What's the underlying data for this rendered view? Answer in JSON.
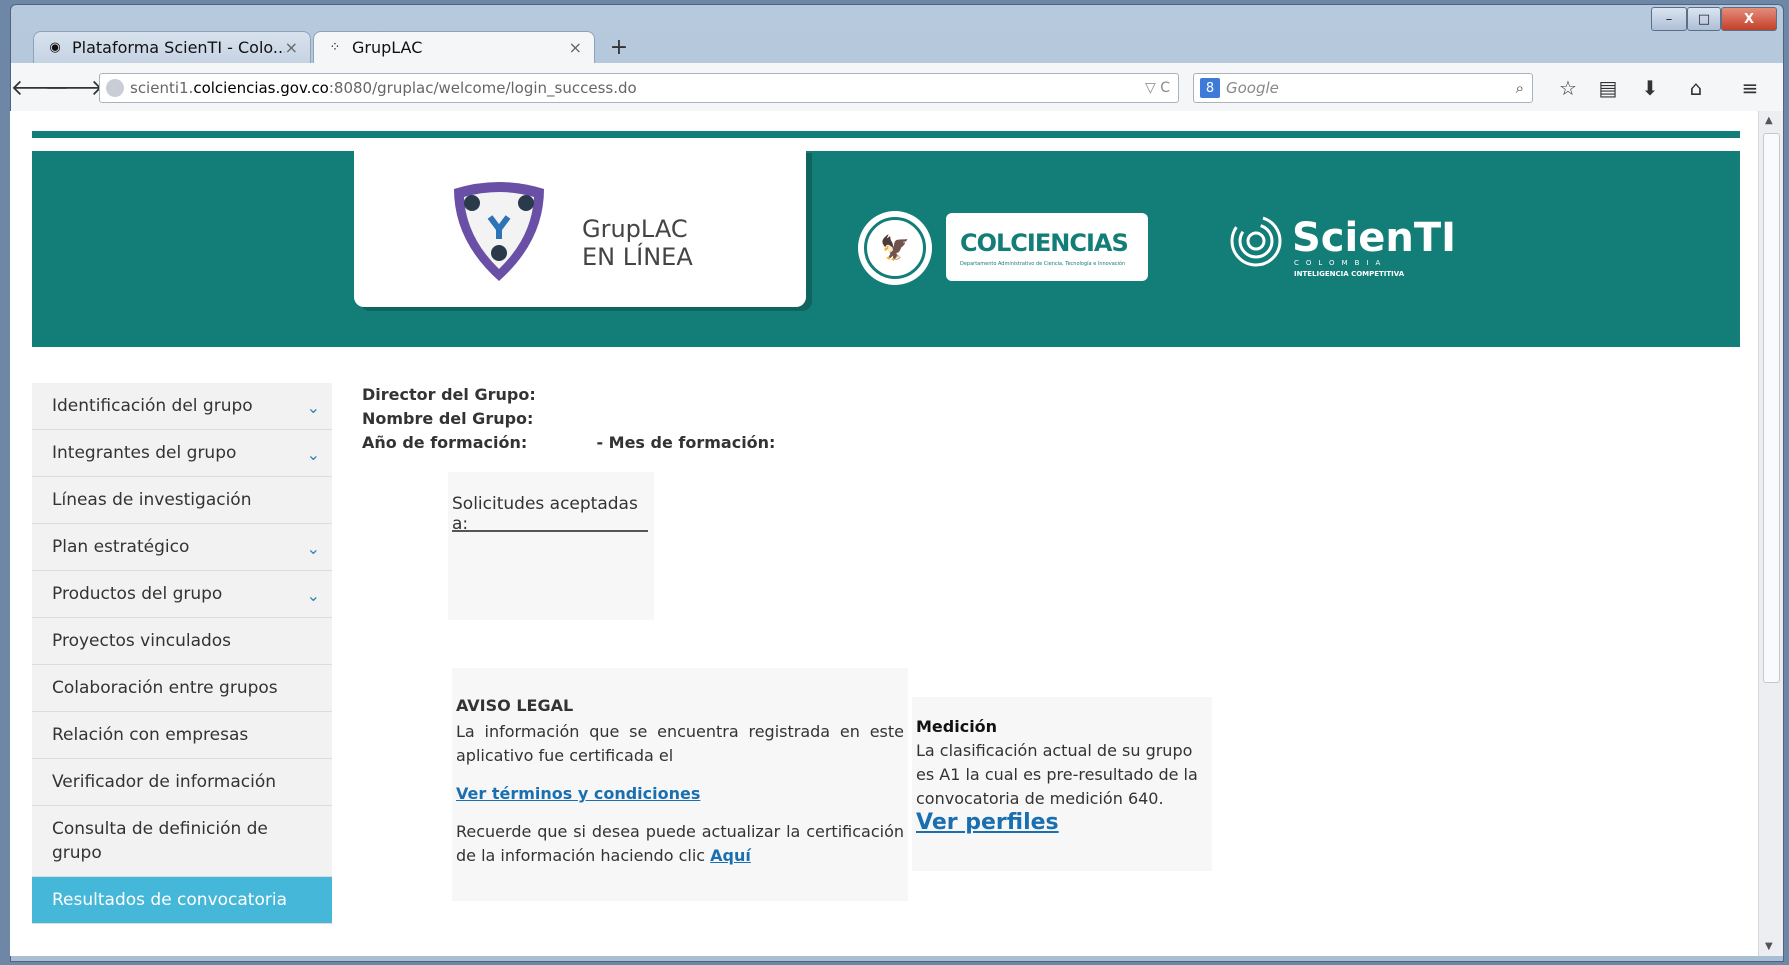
{
  "browser": {
    "tabs": [
      {
        "label": "Plataforma ScienTI - Colo...",
        "close": "×"
      },
      {
        "label": "GrupLAC",
        "close": "×"
      }
    ],
    "new_tab": "+",
    "url": {
      "prefix": "scienti1.",
      "domain": "colciencias.gov.co",
      "rest": ":8080/gruplac/welcome/login_success.do",
      "controls": "▽ C"
    },
    "search_placeholder": "Google",
    "window_controls": {
      "minimize": "–",
      "maximize": "□",
      "close": "X"
    }
  },
  "header": {
    "gruplac_line1": "GrupLAC",
    "gruplac_line2": "EN LÍNEA",
    "colciencias_name": "COLCIENCIAS",
    "colciencias_sub": "Departamento Administrativo de Ciencia, Tecnología e Innovación",
    "scienti_name": "ScienTI",
    "scienti_sub1": "COLOMBIA",
    "scienti_sub2": "INTELIGENCIA COMPETITIVA"
  },
  "sidebar": {
    "items": [
      {
        "label": "Identificación del grupo",
        "chevron": true
      },
      {
        "label": "Integrantes del grupo",
        "chevron": true
      },
      {
        "label": "Líneas de investigación",
        "chevron": false
      },
      {
        "label": "Plan estratégico",
        "chevron": true
      },
      {
        "label": "Productos del grupo",
        "chevron": true
      },
      {
        "label": "Proyectos vinculados",
        "chevron": false
      },
      {
        "label": "Colaboración entre grupos",
        "chevron": false
      },
      {
        "label": "Relación con empresas",
        "chevron": false
      },
      {
        "label": "Verificador de información",
        "chevron": false
      },
      {
        "label": "Consulta de definición de grupo",
        "chevron": false
      },
      {
        "label": "Resultados de convocatoria",
        "chevron": false,
        "active": true
      }
    ]
  },
  "group_info": {
    "director_label": "Director del Grupo:",
    "nombre_label": "Nombre del Grupo:",
    "anio_label": "Año de formación:",
    "mes_label": "- Mes de formación:"
  },
  "solicitudes": {
    "label": "Solicitudes aceptadas a:"
  },
  "aviso": {
    "title": "AVISO LEGAL",
    "text": "La información que se encuentra registrada en este aplicativo fue certificada el",
    "terms_link": "Ver términos y condiciones",
    "update_text": "Recuerde que si desea puede actualizar la certificación de la información haciendo clic",
    "update_link": "Aquí"
  },
  "medicion": {
    "title": "Medición",
    "text": "La clasificación actual de su grupo es A1 la cual es pre-resultado de la convocatoria de medición 640.",
    "link": "Ver perfiles"
  },
  "colors": {
    "teal": "#137d77",
    "active_menu": "#45b7d8",
    "link": "#1a6fb0"
  }
}
